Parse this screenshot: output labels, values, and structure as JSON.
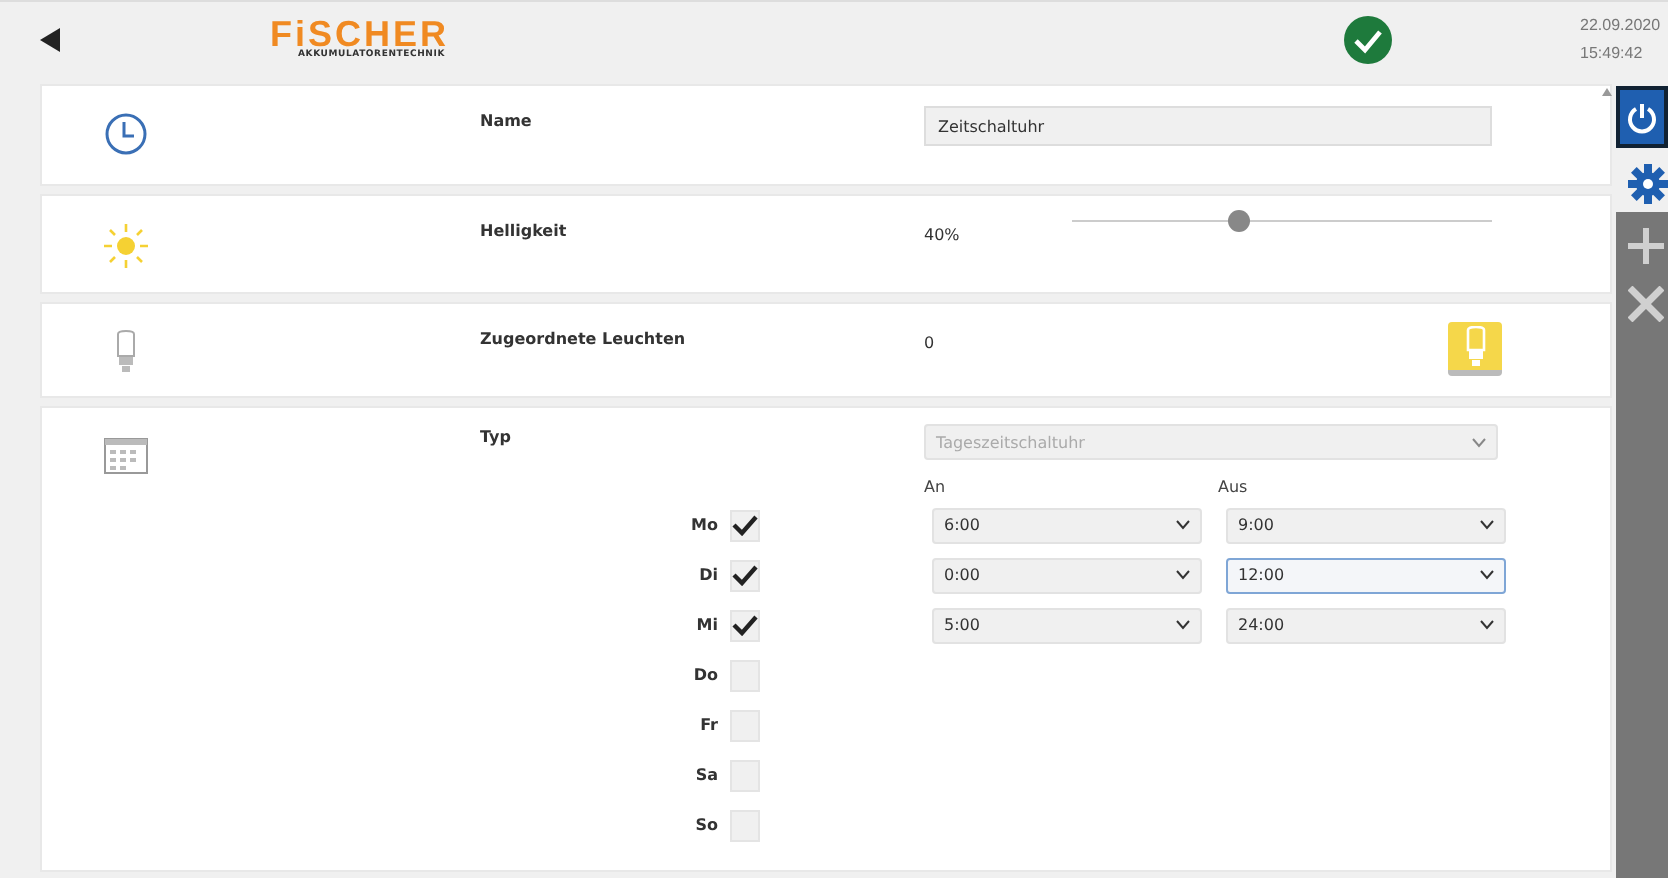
{
  "header": {
    "logo": "FiSCHER",
    "logo_sub": "AKKUMULATORENTECHNIK",
    "date": "22.09.2020",
    "time": "15:49:42",
    "status_ok": true
  },
  "name_row": {
    "label": "Name",
    "value": "Zeitschaltuhr"
  },
  "brightness_row": {
    "label": "Helligkeit",
    "reading": "40%",
    "level": 0.4
  },
  "lights_row": {
    "label": "Zugeordnete Leuchten",
    "count": "0"
  },
  "type_row": {
    "label": "Typ",
    "value": "Tageszeitschaltuhr",
    "on_header": "An",
    "off_header": "Aus"
  },
  "days": [
    {
      "label": "Mo",
      "checked": true,
      "on": "6:00",
      "off": "9:00",
      "focused": false
    },
    {
      "label": "Di",
      "checked": true,
      "on": "0:00",
      "off": "12:00",
      "focused": true
    },
    {
      "label": "Mi",
      "checked": true,
      "on": "5:00",
      "off": "24:00",
      "focused": false
    },
    {
      "label": "Do",
      "checked": false
    },
    {
      "label": "Fr",
      "checked": false
    },
    {
      "label": "Sa",
      "checked": false
    },
    {
      "label": "So",
      "checked": false
    }
  ]
}
